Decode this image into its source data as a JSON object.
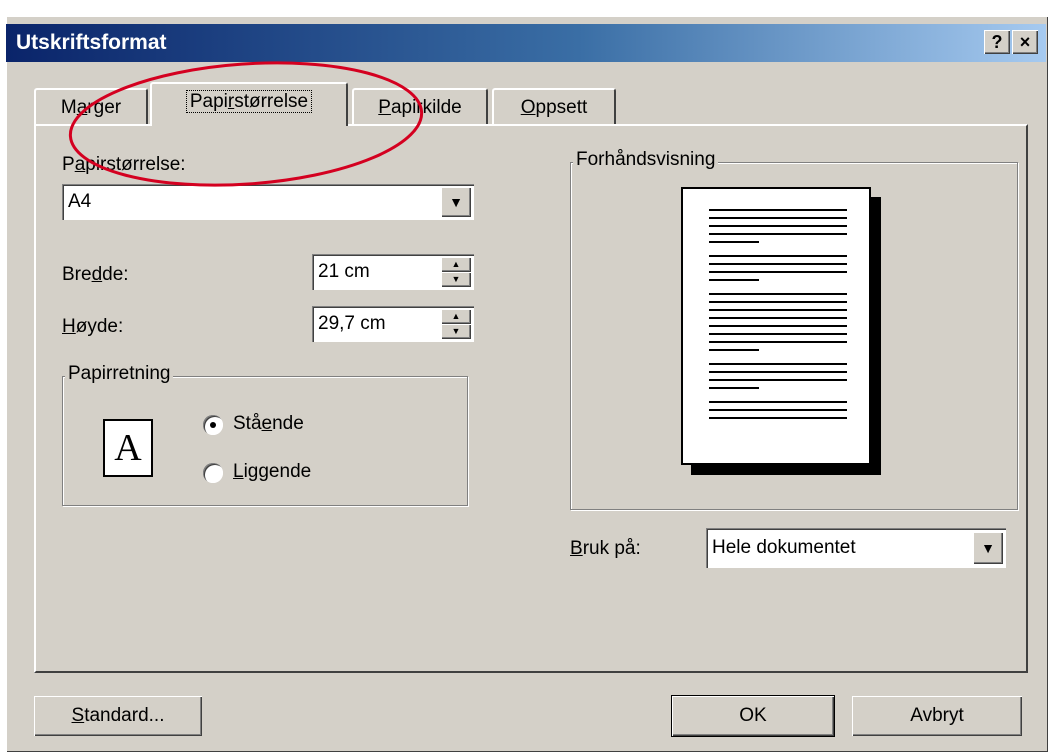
{
  "dialog": {
    "title": "Utskriftsformat",
    "help_label": "?",
    "close_label": "×"
  },
  "tabs": [
    {
      "label_pre": "M",
      "label_u": "a",
      "label_post": "rger"
    },
    {
      "label_pre": "Papi",
      "label_u": "r",
      "label_post": "størrelse"
    },
    {
      "label_pre": "",
      "label_u": "P",
      "label_post": "apirkilde"
    },
    {
      "label_pre": "",
      "label_u": "O",
      "label_post": "ppsett"
    }
  ],
  "paper": {
    "size_label_pre": "P",
    "size_label_u": "a",
    "size_label_post": "pirstørrelse:",
    "size_value": "A4",
    "width_label_pre": "Bre",
    "width_label_u": "d",
    "width_label_post": "de:",
    "width_value": "21 cm",
    "height_label_pre": "",
    "height_label_u": "H",
    "height_label_post": "øyde:",
    "height_value": "29,7 cm"
  },
  "orientation": {
    "group_label": "Papirretning",
    "icon_letter": "A",
    "portrait_pre": "Stå",
    "portrait_u": "e",
    "portrait_post": "nde",
    "landscape_pre": "",
    "landscape_u": "L",
    "landscape_post": "iggende",
    "selected": "portrait"
  },
  "preview": {
    "group_label": "Forhåndsvisning"
  },
  "apply_to": {
    "label_pre": "",
    "label_u": "B",
    "label_post": "ruk på:",
    "value": "Hele dokumentet"
  },
  "buttons": {
    "standard_pre": "",
    "standard_u": "S",
    "standard_post": "tandard...",
    "ok": "OK",
    "cancel": "Avbryt"
  },
  "annotation": {
    "color": "#d40020"
  },
  "icons": {
    "dropdown": "chevron-down-icon",
    "spin_up": "arrow-up-icon",
    "spin_down": "arrow-down-icon"
  }
}
